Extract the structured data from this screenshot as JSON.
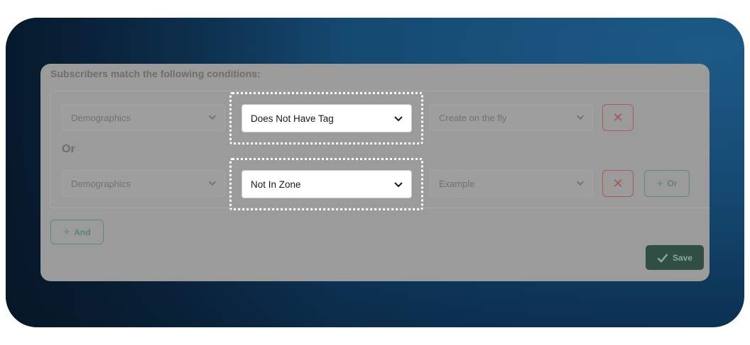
{
  "heading": "Subscribers match the following conditions:",
  "rows": [
    {
      "category": "Demographics",
      "condition": "Does Not Have Tag",
      "value": "Create on the fly",
      "has_or_button": false
    },
    {
      "category": "Demographics",
      "condition": "Not In Zone",
      "value": "Example",
      "has_or_button": true
    }
  ],
  "or_label": "Or",
  "or_button_label": "Or",
  "and_button_label": "And",
  "save_button_label": "Save",
  "icons": {
    "chevron": "chevron-down-icon",
    "remove": "close-icon",
    "plus": "plus-icon",
    "check": "check-icon"
  },
  "colors": {
    "remove": "#a55757",
    "add": "#5d8373",
    "save_bg": "#2f4f44",
    "highlight_border": "#ffffff"
  }
}
